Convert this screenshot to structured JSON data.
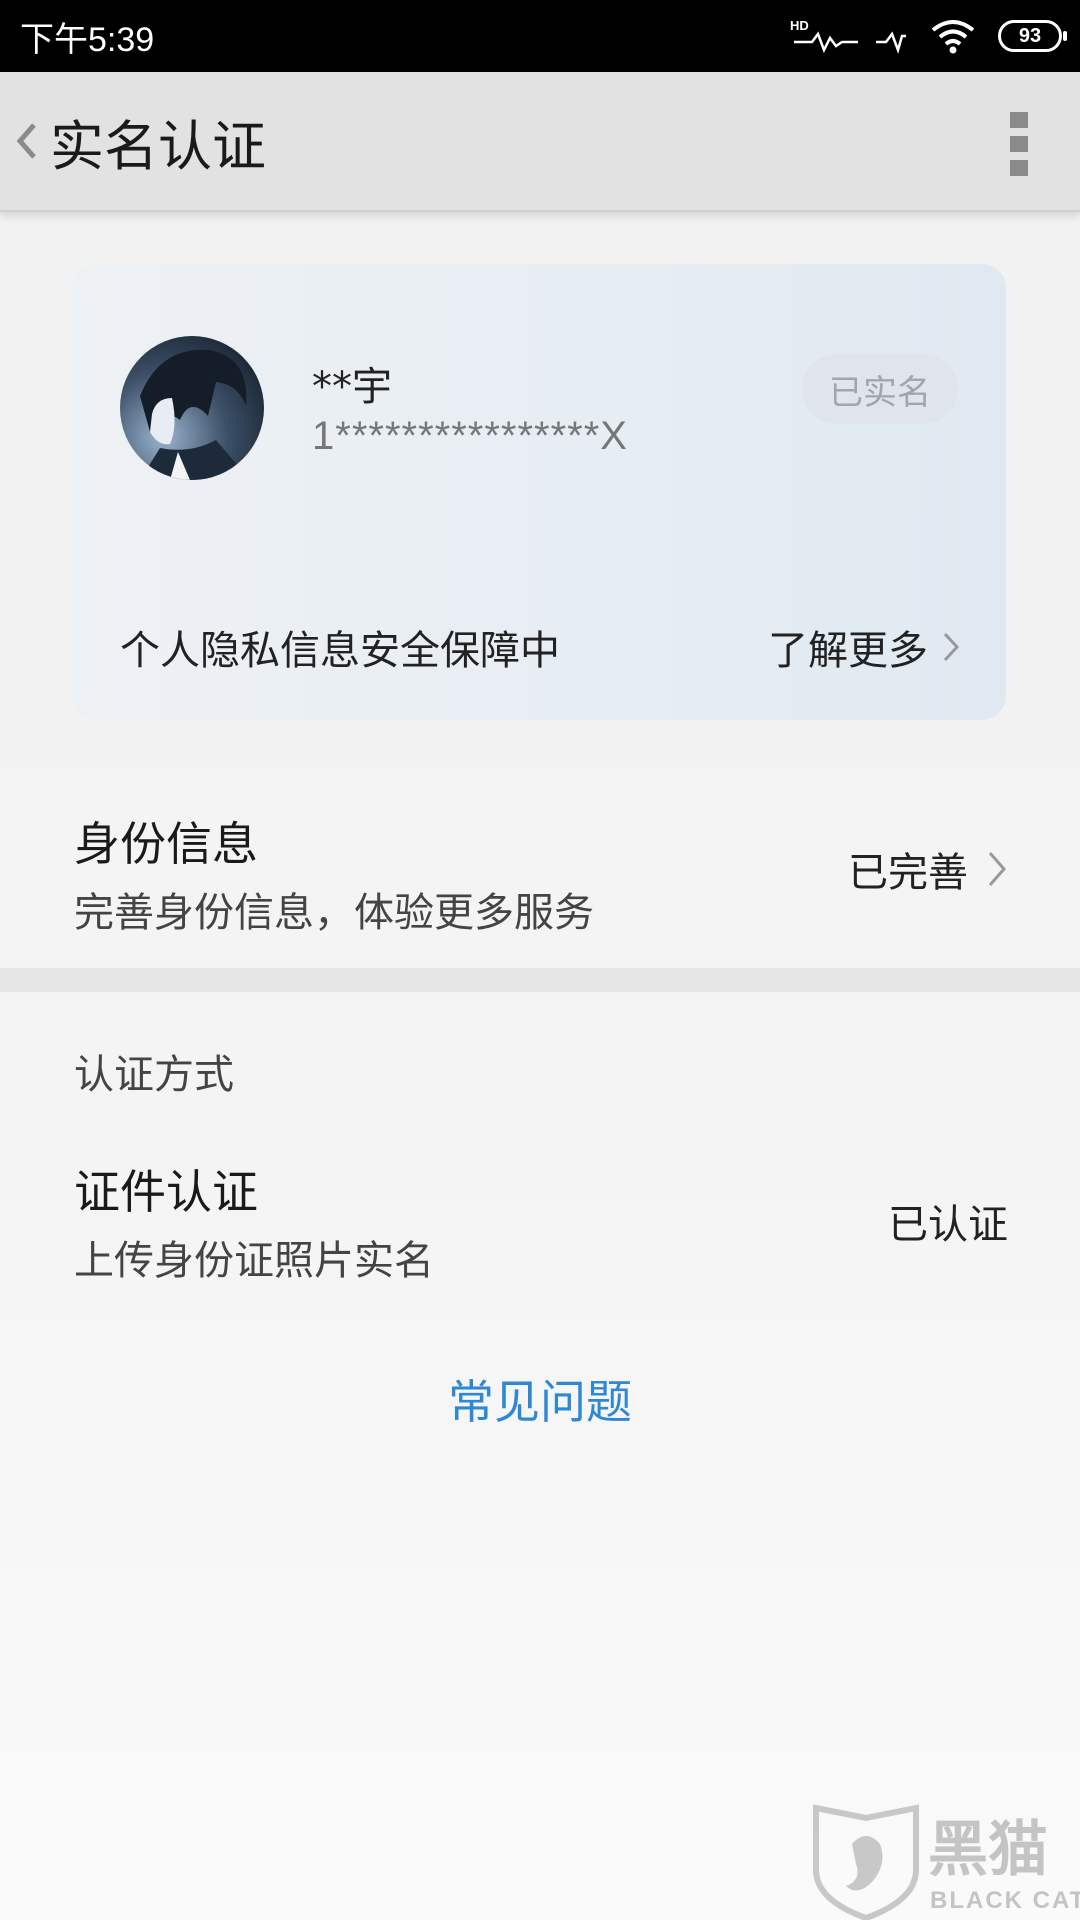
{
  "status_bar": {
    "time": "下午5:39",
    "battery": "93",
    "icons": [
      "hd-call-icon",
      "signal-icon",
      "wifi-icon",
      "battery-icon"
    ]
  },
  "header": {
    "title": "实名认证",
    "icons": [
      "back-icon",
      "more-icon"
    ]
  },
  "profile_card": {
    "name": "**宇",
    "id_number": "1****************X",
    "badge": "已实名",
    "privacy_text": "个人隐私信息安全保障中",
    "learn_more": "了解更多"
  },
  "identity_info": {
    "title": "身份信息",
    "subtitle": "完善身份信息，体验更多服务",
    "status": "已完善"
  },
  "auth_methods": {
    "section_label": "认证方式",
    "method_title": "证件认证",
    "method_subtitle": "上传身份证照片实名",
    "method_status": "已认证"
  },
  "faq": {
    "label": "常见问题"
  },
  "watermark": {
    "text": "黑猫",
    "subtext": "BLACK CAT"
  },
  "colors": {
    "accent_link": "#2f88d4",
    "header_bg": "#e2e2e2",
    "status_bar_bg": "#000000"
  }
}
